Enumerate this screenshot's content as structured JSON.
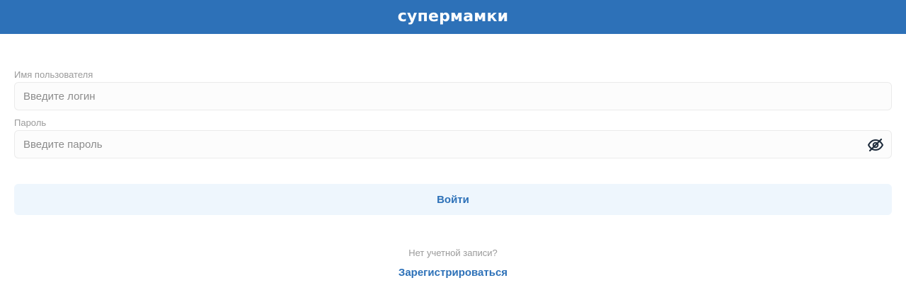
{
  "header": {
    "logo_text": "супермамки",
    "background_color": "#2d71b8"
  },
  "login_form": {
    "username": {
      "label": "Имя пользователя",
      "placeholder": "Введите логин",
      "value": ""
    },
    "password": {
      "label": "Пароль",
      "placeholder": "Введите пароль",
      "value": "",
      "toggle_icon": "eye-slash-icon"
    },
    "submit_label": "Войти",
    "submit_bg_color": "#eef6fd",
    "submit_text_color": "#2d71b8"
  },
  "footer": {
    "no_account_text": "Нет учетной записи?",
    "register_label": "Зарегистрироваться",
    "link_color": "#2d71b8"
  }
}
